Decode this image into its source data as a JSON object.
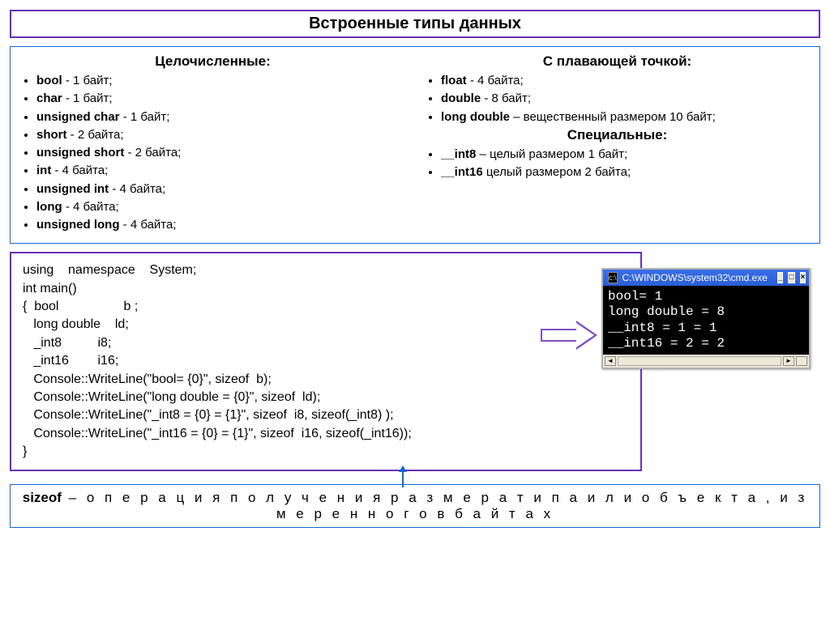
{
  "title": "Встроенные типы данных",
  "integer_heading": "Целочисленные:",
  "integer_types": [
    {
      "name": "bool",
      "desc": "- 1 байт;"
    },
    {
      "name": "char",
      "desc": "- 1 байт;"
    },
    {
      "name": "unsigned  char",
      "desc": "- 1 байт;"
    },
    {
      "name": "short",
      "desc": "- 2 байта;"
    },
    {
      "name": "unsigned  short",
      "desc": "- 2 байта;"
    },
    {
      "name": "int",
      "desc": "- 4 байта;"
    },
    {
      "name": "unsigned  int",
      "desc": "- 4 байта;"
    },
    {
      "name": "long",
      "desc": "- 4 байта;"
    },
    {
      "name": "unsigned  long",
      "desc": "- 4 байта;"
    }
  ],
  "float_heading": "С плавающей точкой:",
  "float_types": [
    {
      "name": "float",
      "desc": "- 4 байта;"
    },
    {
      "name": "double",
      "desc": "- 8 байт;"
    },
    {
      "name": "long double",
      "desc": "– вещественный размером 10 байт;"
    }
  ],
  "special_heading": "Специальные:",
  "special_types": [
    {
      "name": "__int8",
      "desc": "– целый размером 1 байт;"
    },
    {
      "name": "__int16",
      "desc": "целый размером 2 байта;"
    }
  ],
  "code": "using    namespace    System;\nint main()\n{  bool                  b ;\n   long double    ld;\n   _int8          i8;\n   _int16        i16;\n   Console::WriteLine(\"bool= {0}\", sizeof  b);\n   Console::WriteLine(\"long double = {0}\", sizeof  ld);\n   Console::WriteLine(\"_int8 = {0} = {1}\", sizeof  i8, sizeof(_int8) );\n   Console::WriteLine(\"_int16 = {0} = {1}\", sizeof  i16, sizeof(_int16));\n}",
  "cmd_title": "C:\\WINDOWS\\system32\\cmd.exe",
  "cmd_output": "bool= 1\nlong double = 8\n__int8 = 1 = 1\n__int16 = 2 = 2",
  "sizeof_kw": "sizeof",
  "sizeof_note": " – о п е р а ц и я   п о л у ч е н и я   р а з м е р а   т и п а   и л и   о б ъ е к т а , и з м е р е н н о г о   в   б а й т а х"
}
